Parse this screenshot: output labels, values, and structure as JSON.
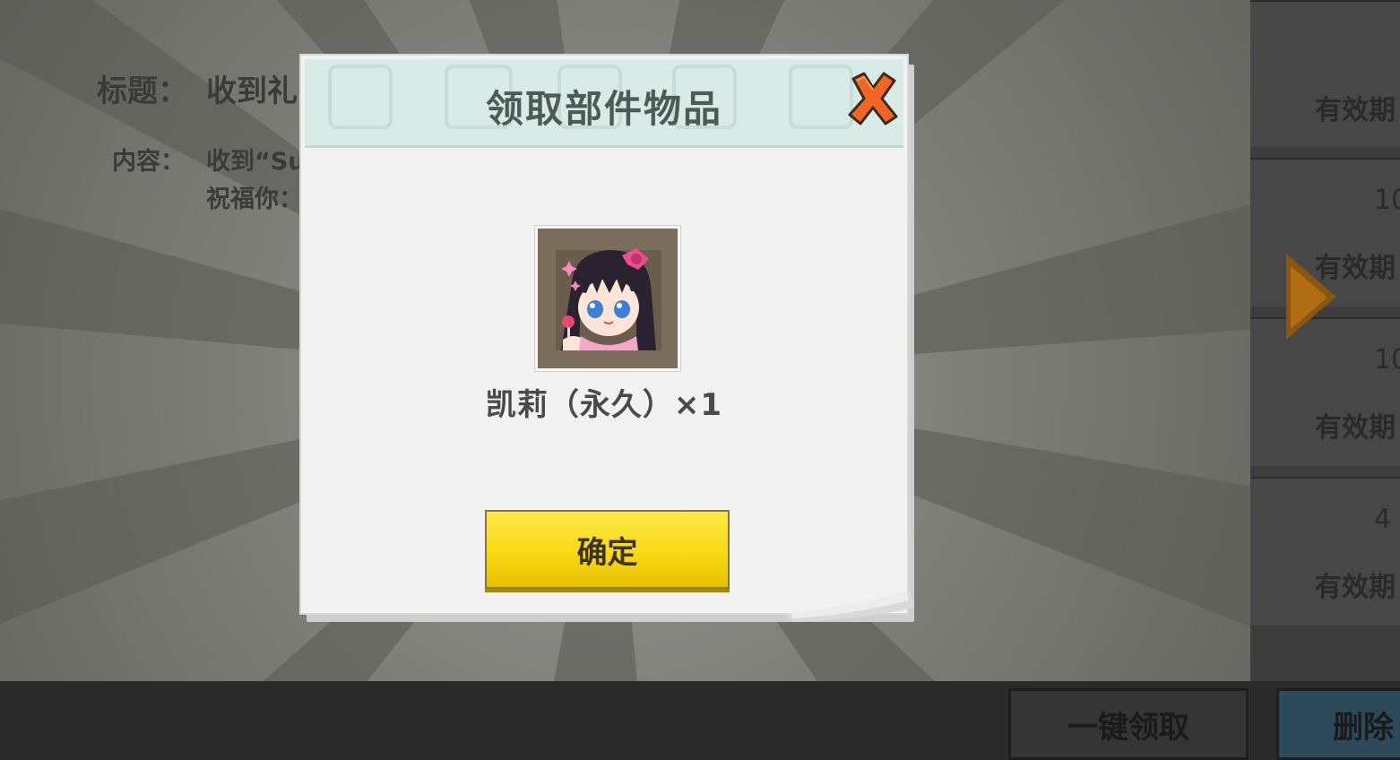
{
  "mail": {
    "title_label": "标题：",
    "title_text": "收到礼",
    "content_label": "内容：",
    "content_line1": "收到“Su",
    "content_line2": "祝福你："
  },
  "mail_list": {
    "expire_label": "有效期",
    "items": [
      {
        "count": ""
      },
      {
        "count": "10"
      },
      {
        "count": "10"
      },
      {
        "count": "4"
      }
    ]
  },
  "bottom": {
    "claim_all_label": "一键领取",
    "delete_label": "删除"
  },
  "modal": {
    "title": "领取部件物品",
    "item_name": "凯莉（永久）×1",
    "confirm_label": "确定"
  },
  "colors": {
    "confirm_button": "#f9d913",
    "close_icon": "#f26522",
    "header_bg": "#d9ebe6"
  }
}
